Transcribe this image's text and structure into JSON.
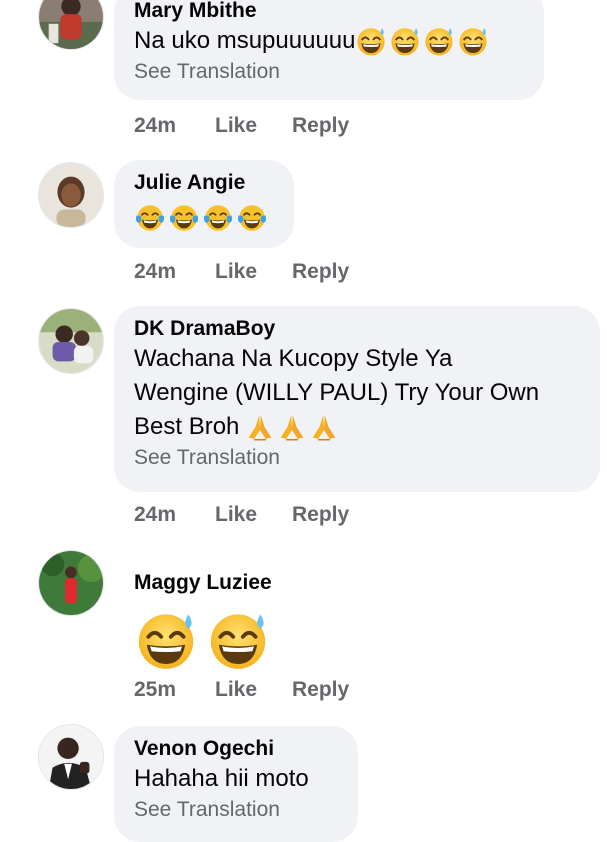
{
  "comments": [
    {
      "name": "Mary Mbithe",
      "text": "Na uko msupuuuuuu",
      "emoji": "grinning-sweat-face",
      "emoji_count": 4,
      "see_translation": "See Translation",
      "time": "24m",
      "like": "Like",
      "reply": "Reply"
    },
    {
      "name": "Julie Angie",
      "text": "",
      "emoji": "tears-of-joy-face",
      "emoji_count": 4,
      "time": "24m",
      "like": "Like",
      "reply": "Reply"
    },
    {
      "name": "DK DramaBoy",
      "text_lines": [
        "Wachana Na Kucopy Style Ya",
        "Wengine (WILLY PAUL) Try Your Own",
        "Best Broh"
      ],
      "emoji": "folded-hands",
      "emoji_count": 3,
      "see_translation": "See Translation",
      "time": "24m",
      "like": "Like",
      "reply": "Reply"
    },
    {
      "name": "Maggy Luziee",
      "emoji": "grinning-sweat-face",
      "emoji_count": 2,
      "time": "25m",
      "like": "Like",
      "reply": "Reply"
    },
    {
      "name": "Venon Ogechi",
      "text": "Hahaha hii moto",
      "see_translation": "See Translation"
    }
  ],
  "colors": {
    "bubble": "#f0f2f5",
    "meta_text": "#65676b",
    "primary_text": "#050505"
  }
}
